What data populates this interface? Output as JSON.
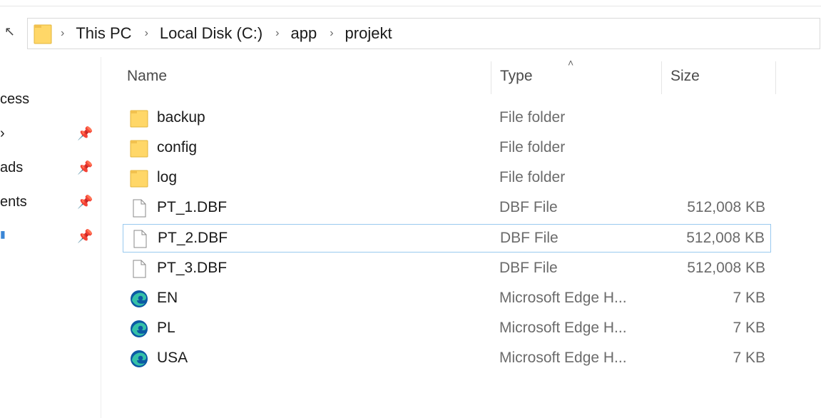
{
  "breadcrumb": [
    "This PC",
    "Local Disk (C:)",
    "app",
    "projekt"
  ],
  "nav": {
    "items": [
      {
        "label": "cess",
        "pinned": false
      },
      {
        "label": "",
        "pinned": true
      },
      {
        "label": "ads",
        "pinned": true
      },
      {
        "label": "ents",
        "pinned": true
      },
      {
        "label": "",
        "pinned": true
      }
    ]
  },
  "columns": {
    "name": "Name",
    "type": "Type",
    "size": "Size"
  },
  "files": [
    {
      "name": "backup",
      "type": "File folder",
      "size": "",
      "icon": "folder-icon"
    },
    {
      "name": "config",
      "type": "File folder",
      "size": "",
      "icon": "folder-icon"
    },
    {
      "name": "log",
      "type": "File folder",
      "size": "",
      "icon": "folder-icon"
    },
    {
      "name": "PT_1.DBF",
      "type": "DBF File",
      "size": "512,008 KB",
      "icon": "file-icon"
    },
    {
      "name": "PT_2.DBF",
      "type": "DBF File",
      "size": "512,008 KB",
      "icon": "file-icon",
      "selected": true
    },
    {
      "name": "PT_3.DBF",
      "type": "DBF File",
      "size": "512,008 KB",
      "icon": "file-icon"
    },
    {
      "name": "EN",
      "type": "Microsoft Edge H...",
      "size": "7 KB",
      "icon": "edge-icon"
    },
    {
      "name": "PL",
      "type": "Microsoft Edge H...",
      "size": "7 KB",
      "icon": "edge-icon"
    },
    {
      "name": "USA",
      "type": "Microsoft Edge H...",
      "size": "7 KB",
      "icon": "edge-icon"
    }
  ],
  "colors": {
    "folder": "#ffd768",
    "selection_border": "#99c9ef",
    "edge_blue": "#0c59a4",
    "edge_green": "#35c1a7"
  }
}
